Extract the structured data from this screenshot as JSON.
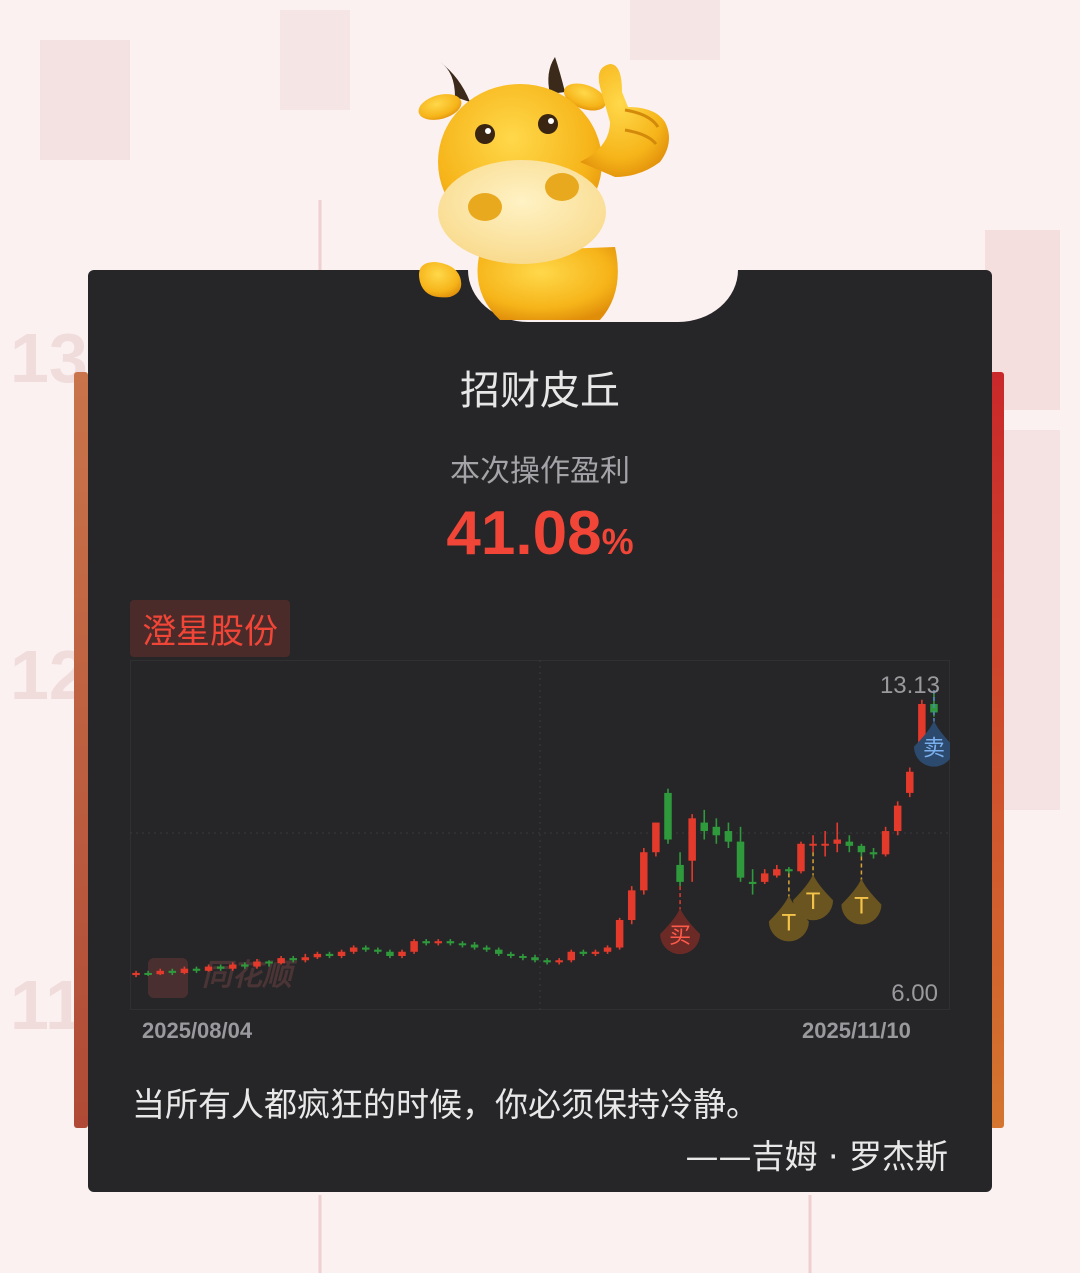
{
  "title": "招财皮丘",
  "subtitle": "本次操作盈利",
  "profit": {
    "value": "41.08",
    "unit": "%"
  },
  "stock_name": "澄星股份",
  "watermark": "同花顺",
  "background_numbers": [
    "13",
    "12",
    "11"
  ],
  "colors": {
    "up": "#e33a2c",
    "down": "#2f9a3c",
    "profit": "#f04537",
    "card": "#262628"
  },
  "chart_data": {
    "type": "candlestick",
    "x_start": "2025/08/04",
    "x_end": "2025/11/10",
    "ylim": [
      6.0,
      13.13
    ],
    "y_max_label": "13.13",
    "y_min_label": "6.00",
    "candles": [
      [
        6.4,
        6.45,
        6.35,
        6.5
      ],
      [
        6.45,
        6.42,
        6.38,
        6.5
      ],
      [
        6.42,
        6.5,
        6.4,
        6.55
      ],
      [
        6.5,
        6.45,
        6.4,
        6.55
      ],
      [
        6.45,
        6.55,
        6.42,
        6.6
      ],
      [
        6.55,
        6.5,
        6.45,
        6.6
      ],
      [
        6.5,
        6.6,
        6.48,
        6.65
      ],
      [
        6.6,
        6.55,
        6.5,
        6.65
      ],
      [
        6.55,
        6.65,
        6.5,
        6.7
      ],
      [
        6.65,
        6.6,
        6.55,
        6.7
      ],
      [
        6.6,
        6.72,
        6.55,
        6.78
      ],
      [
        6.72,
        6.68,
        6.6,
        6.75
      ],
      [
        6.68,
        6.8,
        6.65,
        6.85
      ],
      [
        6.8,
        6.75,
        6.7,
        6.85
      ],
      [
        6.75,
        6.82,
        6.7,
        6.9
      ],
      [
        6.82,
        6.9,
        6.78,
        6.95
      ],
      [
        6.9,
        6.85,
        6.8,
        6.95
      ],
      [
        6.85,
        6.95,
        6.8,
        7.0
      ],
      [
        6.95,
        7.05,
        6.9,
        7.1
      ],
      [
        7.05,
        7.0,
        6.95,
        7.1
      ],
      [
        7.0,
        6.95,
        6.9,
        7.05
      ],
      [
        6.95,
        6.85,
        6.8,
        7.0
      ],
      [
        6.85,
        6.95,
        6.8,
        7.0
      ],
      [
        6.95,
        7.2,
        6.9,
        7.25
      ],
      [
        7.2,
        7.15,
        7.1,
        7.25
      ],
      [
        7.15,
        7.2,
        7.1,
        7.25
      ],
      [
        7.2,
        7.15,
        7.1,
        7.25
      ],
      [
        7.15,
        7.12,
        7.05,
        7.2
      ],
      [
        7.12,
        7.05,
        7.0,
        7.18
      ],
      [
        7.05,
        7.0,
        6.95,
        7.1
      ],
      [
        7.0,
        6.9,
        6.85,
        7.05
      ],
      [
        6.9,
        6.85,
        6.8,
        6.95
      ],
      [
        6.85,
        6.82,
        6.75,
        6.9
      ],
      [
        6.82,
        6.75,
        6.7,
        6.88
      ],
      [
        6.75,
        6.7,
        6.65,
        6.8
      ],
      [
        6.7,
        6.75,
        6.65,
        6.8
      ],
      [
        6.75,
        6.95,
        6.7,
        7.0
      ],
      [
        6.95,
        6.9,
        6.85,
        7.0
      ],
      [
        6.9,
        6.95,
        6.85,
        7.0
      ],
      [
        6.95,
        7.05,
        6.9,
        7.1
      ],
      [
        7.05,
        7.7,
        7.0,
        7.75
      ],
      [
        7.7,
        8.4,
        7.6,
        8.5
      ],
      [
        8.4,
        9.3,
        8.3,
        9.4
      ],
      [
        9.3,
        10.0,
        9.2,
        10.0
      ],
      [
        10.7,
        9.6,
        9.5,
        10.8
      ],
      [
        9.0,
        8.6,
        8.5,
        9.3
      ],
      [
        9.1,
        10.1,
        8.6,
        10.2
      ],
      [
        10.0,
        9.8,
        9.6,
        10.3
      ],
      [
        9.9,
        9.7,
        9.5,
        10.1
      ],
      [
        9.8,
        9.55,
        9.4,
        10.0
      ],
      [
        9.55,
        8.7,
        8.6,
        9.9
      ],
      [
        8.6,
        8.55,
        8.3,
        8.9
      ],
      [
        8.6,
        8.8,
        8.55,
        8.9
      ],
      [
        8.75,
        8.9,
        8.7,
        9.0
      ],
      [
        8.9,
        8.85,
        8.8,
        8.95
      ],
      [
        8.85,
        9.5,
        8.8,
        9.55
      ],
      [
        9.5,
        9.5,
        9.3,
        9.7
      ],
      [
        9.5,
        9.5,
        9.2,
        9.8
      ],
      [
        9.5,
        9.6,
        9.3,
        10.0
      ],
      [
        9.55,
        9.45,
        9.3,
        9.7
      ],
      [
        9.45,
        9.3,
        9.2,
        9.5
      ],
      [
        9.3,
        9.25,
        9.15,
        9.4
      ],
      [
        9.25,
        9.8,
        9.2,
        9.9
      ],
      [
        9.8,
        10.4,
        9.7,
        10.5
      ],
      [
        10.7,
        11.2,
        10.6,
        11.3
      ],
      [
        11.8,
        12.8,
        11.6,
        12.9
      ],
      [
        12.8,
        12.6,
        12.5,
        13.13
      ]
    ],
    "markers": [
      {
        "label": "买",
        "candle": 45
      },
      {
        "label": "T",
        "candle": 54
      },
      {
        "label": "T",
        "candle": 56
      },
      {
        "label": "T",
        "candle": 60
      },
      {
        "label": "卖",
        "candle": 66
      }
    ]
  },
  "quote": "当所有人都疯狂的时候，你必须保持冷静。",
  "author": "——吉姆 · 罗杰斯"
}
